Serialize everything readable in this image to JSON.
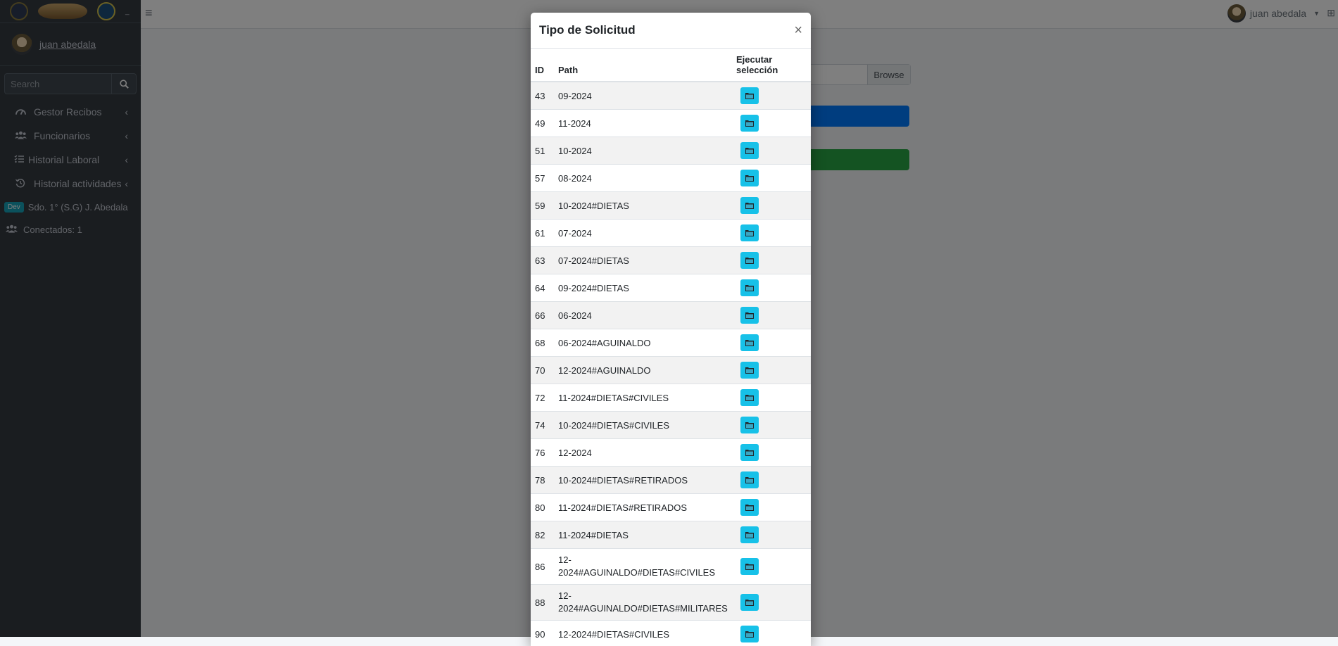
{
  "sidebar": {
    "user_name": "juan abedala",
    "search_placeholder": "Search",
    "items": [
      {
        "label": "Gestor Recibos",
        "icon": "dashboard-icon"
      },
      {
        "label": "Funcionarios",
        "icon": "users-icon"
      },
      {
        "label": "Historial Laboral",
        "icon": "list-check-icon"
      },
      {
        "label": "Historial actividades",
        "icon": "history-icon"
      }
    ],
    "dev_badge": "Dev",
    "dev_name": "Sdo. 1° (S.G) J. Abedala",
    "connected": "Conectados: 1"
  },
  "navbar": {
    "user_name": "juan abedala"
  },
  "background": {
    "browse_label": "Browse"
  },
  "modal": {
    "title": "Tipo de Solicitud",
    "close_label": "×",
    "columns": {
      "id": "ID",
      "path": "Path",
      "exec": "Ejecutar selección"
    },
    "rows": [
      {
        "id": "43",
        "path": "09-2024"
      },
      {
        "id": "49",
        "path": "11-2024"
      },
      {
        "id": "51",
        "path": "10-2024"
      },
      {
        "id": "57",
        "path": "08-2024"
      },
      {
        "id": "59",
        "path": "10-2024#DIETAS"
      },
      {
        "id": "61",
        "path": "07-2024"
      },
      {
        "id": "63",
        "path": "07-2024#DIETAS"
      },
      {
        "id": "64",
        "path": "09-2024#DIETAS"
      },
      {
        "id": "66",
        "path": "06-2024"
      },
      {
        "id": "68",
        "path": "06-2024#AGUINALDO"
      },
      {
        "id": "70",
        "path": "12-2024#AGUINALDO"
      },
      {
        "id": "72",
        "path": "11-2024#DIETAS#CIVILES"
      },
      {
        "id": "74",
        "path": "10-2024#DIETAS#CIVILES"
      },
      {
        "id": "76",
        "path": "12-2024"
      },
      {
        "id": "78",
        "path": "10-2024#DIETAS#RETIRADOS"
      },
      {
        "id": "80",
        "path": "11-2024#DIETAS#RETIRADOS"
      },
      {
        "id": "82",
        "path": "11-2024#DIETAS"
      },
      {
        "id": "86",
        "path": "12-2024#AGUINALDO#DIETAS#CIVILES"
      },
      {
        "id": "88",
        "path": "12-2024#AGUINALDO#DIETAS#MILITARES"
      },
      {
        "id": "90",
        "path": "12-2024#DIETAS#CIVILES"
      }
    ]
  },
  "colors": {
    "sidebar_bg": "#343a40",
    "folder_button": "#17c1e8",
    "primary": "#007bff",
    "success": "#28a745"
  }
}
